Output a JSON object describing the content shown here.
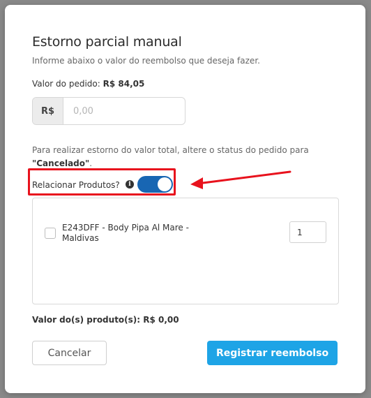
{
  "modal": {
    "title": "Estorno parcial manual",
    "subtitle": "Informe abaixo o valor do reembolso que deseja fazer."
  },
  "order": {
    "label": "Valor do pedido: ",
    "value": "R$ 84,05"
  },
  "amount": {
    "currency_prefix": "R$",
    "placeholder": "0,00",
    "value": ""
  },
  "notice": {
    "text": "Para realizar estorno do valor total, altere o status do pedido para ",
    "status_quoted": "\"Cancelado\"",
    "suffix": "."
  },
  "relate_products": {
    "label": "Relacionar Produtos?",
    "info_icon": "info-icon",
    "toggle_on": true
  },
  "products": [
    {
      "name": "E243DFF - Body Pipa Al Mare - Maldivas",
      "checked": false,
      "quantity": "1"
    }
  ],
  "products_total": {
    "text": "Valor do(s) produto(s): R$ 0,00"
  },
  "actions": {
    "cancel_label": "Cancelar",
    "submit_label": "Registrar reembolso"
  },
  "colors": {
    "primary": "#1ea4e6",
    "toggle": "#1866b3",
    "annotation": "#e8121d"
  }
}
